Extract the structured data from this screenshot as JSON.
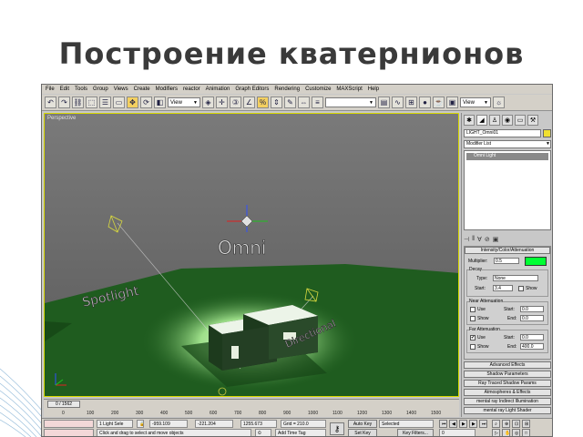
{
  "slide_title": "Построение кватернионов",
  "menu": [
    "File",
    "Edit",
    "Tools",
    "Group",
    "Views",
    "Create",
    "Modifiers",
    "reactor",
    "Animation",
    "Graph Editors",
    "Rendering",
    "Customize",
    "MAXScript",
    "Help"
  ],
  "toolbar": {
    "view_select": "View",
    "view_select_right": "View"
  },
  "viewport": {
    "label": "Perspective",
    "labels": {
      "omni": "Omni",
      "spotlight": "Spotlight",
      "directional": "Directional"
    }
  },
  "timeline": {
    "frame": "0 / 1562",
    "ticks": [
      "0",
      "100",
      "200",
      "300",
      "400",
      "500",
      "600",
      "700",
      "800",
      "900",
      "1000",
      "1100",
      "1200",
      "1300",
      "1400",
      "1500"
    ]
  },
  "status": {
    "selection": "1 Light Sele",
    "x": "-959.109",
    "y": "-221.204",
    "z": "1255.673",
    "grid": "Grid = 210.0",
    "prompt": "Click and drag to select and move objects",
    "add_time_tag": "Add Time Tag",
    "auto_key": "Auto Key",
    "set_key": "Set Key",
    "selected": "Selected",
    "key_filters": "Key Filters...",
    "frame_field": "0"
  },
  "panel": {
    "object_name": "LIGHT_Omni01",
    "modifier_list": "Modifier List",
    "stack_item": "Omni Light",
    "intensity": {
      "title": "Intensity/Color/Attenuation",
      "multiplier_label": "Multiplier:",
      "multiplier": "0.5",
      "color": "#00ff33"
    },
    "decay": {
      "title": "Decay",
      "type_label": "Type:",
      "type": "None",
      "start_label": "Start:",
      "start": "3.4",
      "show_label": "Show"
    },
    "near": {
      "title": "Near Attenuation",
      "use": "Use",
      "show": "Show",
      "start_label": "Start:",
      "start": "0.0",
      "end_label": "End:",
      "end": "0.0"
    },
    "far": {
      "title": "Far Attenuation",
      "use": "Use",
      "show": "Show",
      "start_label": "Start:",
      "start": "0.0",
      "end_label": "End:",
      "end": "400.0"
    },
    "rollouts": [
      "Advanced Effects",
      "Shadow Parameters",
      "Ray Traced Shadow Params",
      "Atmospheres & Effects",
      "mental ray Indirect Illumination",
      "mental ray Light Shader"
    ]
  },
  "colors": {
    "title": "#3a3a3a",
    "viewport_bg": "#6e6e6e",
    "ground": "#1f5c1f",
    "ui_bg": "#d4d0c8",
    "selected_frame": "#d8d800"
  }
}
